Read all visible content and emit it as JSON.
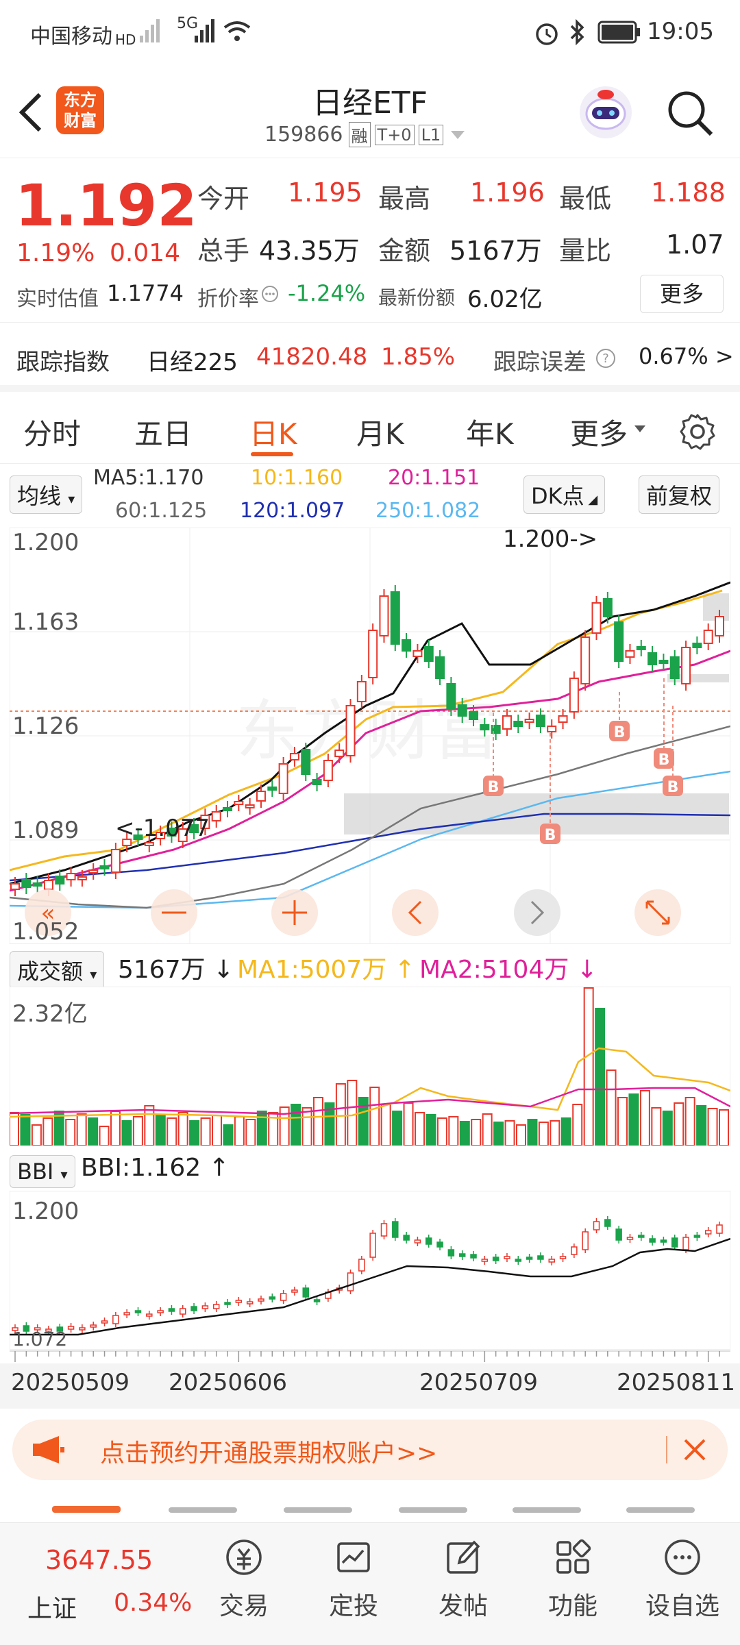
{
  "status_bar": {
    "carrier": "中国移动",
    "carrier_suffix": "HD",
    "network": "5G",
    "time": "19:05"
  },
  "header": {
    "back_icon": "back-arrow-icon",
    "logo_text_1": "东方",
    "logo_text_2": "财富",
    "title": "日经ETF",
    "code": "159866",
    "tags": [
      "融",
      "T+0",
      "L1"
    ],
    "robot_icon": "robot-icon",
    "search_icon": "search-icon"
  },
  "quote": {
    "price": "1.192",
    "change_pct": "1.19%",
    "change": "0.014",
    "open_label": "今开",
    "open": "1.195",
    "high_label": "最高",
    "high": "1.196",
    "low_label": "最低",
    "low": "1.188",
    "volume_label": "总手",
    "volume": "43.35万",
    "amount_label": "金额",
    "amount": "5167万",
    "ratio_label": "量比",
    "ratio": "1.07",
    "iopv_label": "实时估值",
    "iopv": "1.1774",
    "discount_label": "折价率",
    "discount": "-1.24%",
    "shares_label": "最新份额",
    "shares": "6.02亿",
    "more_button": "更多"
  },
  "tracking": {
    "index_label": "跟踪指数",
    "index_name": "日经225",
    "index_value": "41820.48",
    "index_pct": "1.85%",
    "error_label": "跟踪误差",
    "error_value": "0.67% >"
  },
  "tabs": {
    "items": [
      "分时",
      "五日",
      "日K",
      "月K",
      "年K",
      "更多"
    ],
    "active": "日K"
  },
  "indicators": {
    "ma_select": "均线",
    "ma5": "MA5:1.170",
    "ma10": "10:1.160",
    "ma20": "20:1.151",
    "ma60": "60:1.125",
    "ma120": "120:1.097",
    "ma250": "250:1.082",
    "dk_button": "DK点",
    "adjust_button": "前复权"
  },
  "kline": {
    "y_labels": [
      "1.200",
      "1.163",
      "1.126",
      "1.089",
      "1.052"
    ],
    "max_label": "1.200->",
    "min_label": "<-1.077",
    "buy_marker": "B"
  },
  "volume": {
    "select": "成交额",
    "value": "5167万",
    "ma1": "MA1:5007万",
    "ma2": "MA2:5104万",
    "max_label": "2.32亿"
  },
  "bbi": {
    "select": "BBI",
    "value": "BBI:1.162",
    "top_label": "1.200",
    "bottom_label": "1.072"
  },
  "dates": [
    "20250509",
    "20250606",
    "20250709",
    "20250811"
  ],
  "promo": {
    "text": "点击预约开通股票期权账户>>"
  },
  "bottom_nav": {
    "index_value": "3647.55",
    "index_name": "上证",
    "index_pct": "0.34%",
    "items": [
      "交易",
      "定投",
      "发帖",
      "功能",
      "设自选"
    ]
  },
  "colors": {
    "up": "#e8372c",
    "down": "#1aa34a",
    "accent": "#f0591b"
  }
}
